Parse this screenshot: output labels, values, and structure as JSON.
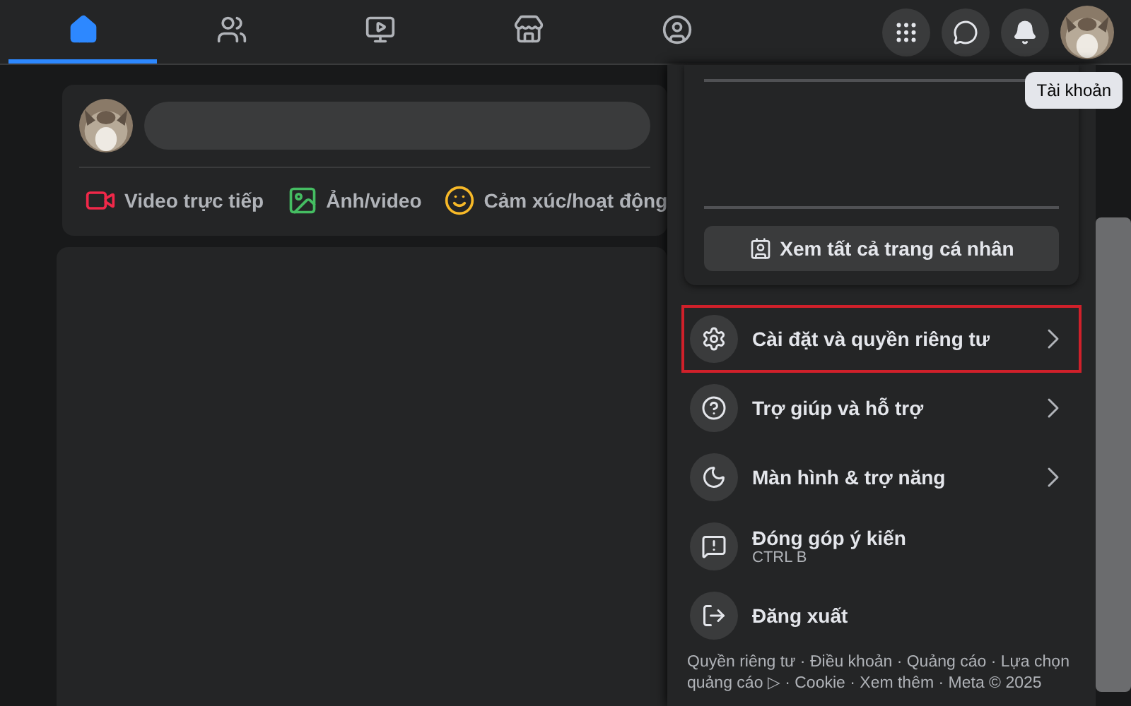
{
  "nav": {
    "tabs": [
      {
        "selected": true
      },
      {
        "selected": false
      },
      {
        "selected": false
      },
      {
        "selected": false
      },
      {
        "selected": false
      }
    ]
  },
  "composer": {
    "actions": [
      {
        "label": "Video trực tiếp"
      },
      {
        "label": "Ảnh/video"
      },
      {
        "label": "Cảm xúc/hoạt động"
      }
    ]
  },
  "tooltip": "Tài khoản",
  "account_menu": {
    "profile_button": "Xem tất cả trang cá nhân",
    "items": [
      {
        "label": "Cài đặt và quyền riêng tư",
        "submenu": true,
        "highlighted": true
      },
      {
        "label": "Trợ giúp và hỗ trợ",
        "submenu": true,
        "highlighted": false
      },
      {
        "label": "Màn hình & trợ năng",
        "submenu": true,
        "highlighted": false
      },
      {
        "label": "Đóng góp ý kiến",
        "shortcut": "CTRL B",
        "submenu": false,
        "highlighted": false
      },
      {
        "label": "Đăng xuất",
        "submenu": false,
        "highlighted": false
      }
    ],
    "footer": "Quyền riêng tư · Điều khoản · Quảng cáo · Lựa chọn quảng cáo ▷ · Cookie · Xem thêm · Meta © 2025"
  }
}
